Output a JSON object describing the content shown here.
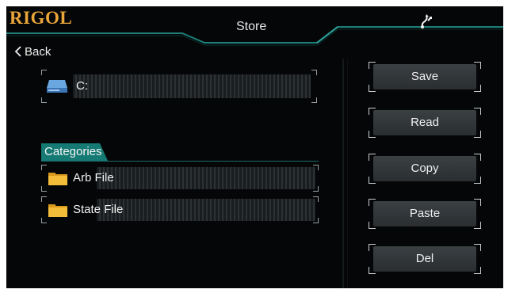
{
  "header": {
    "brand": "RIGOL",
    "title": "Store"
  },
  "nav": {
    "back_label": "Back"
  },
  "drive": {
    "label": "C:"
  },
  "categories": {
    "label": "Categories",
    "items": [
      {
        "label": "Arb File"
      },
      {
        "label": "State File"
      }
    ]
  },
  "buttons": {
    "save": "Save",
    "read": "Read",
    "copy": "Copy",
    "paste": "Paste",
    "del": "Del"
  },
  "colors": {
    "brand": "#e9a53a",
    "accent": "#1f8c86",
    "background": "#050607",
    "folder": "#f0b731",
    "drive": "#4c88c8"
  },
  "icons": {
    "usb": "usb-icon",
    "back": "chevron-left-icon",
    "drive": "hard-drive-icon",
    "folder": "folder-icon"
  }
}
